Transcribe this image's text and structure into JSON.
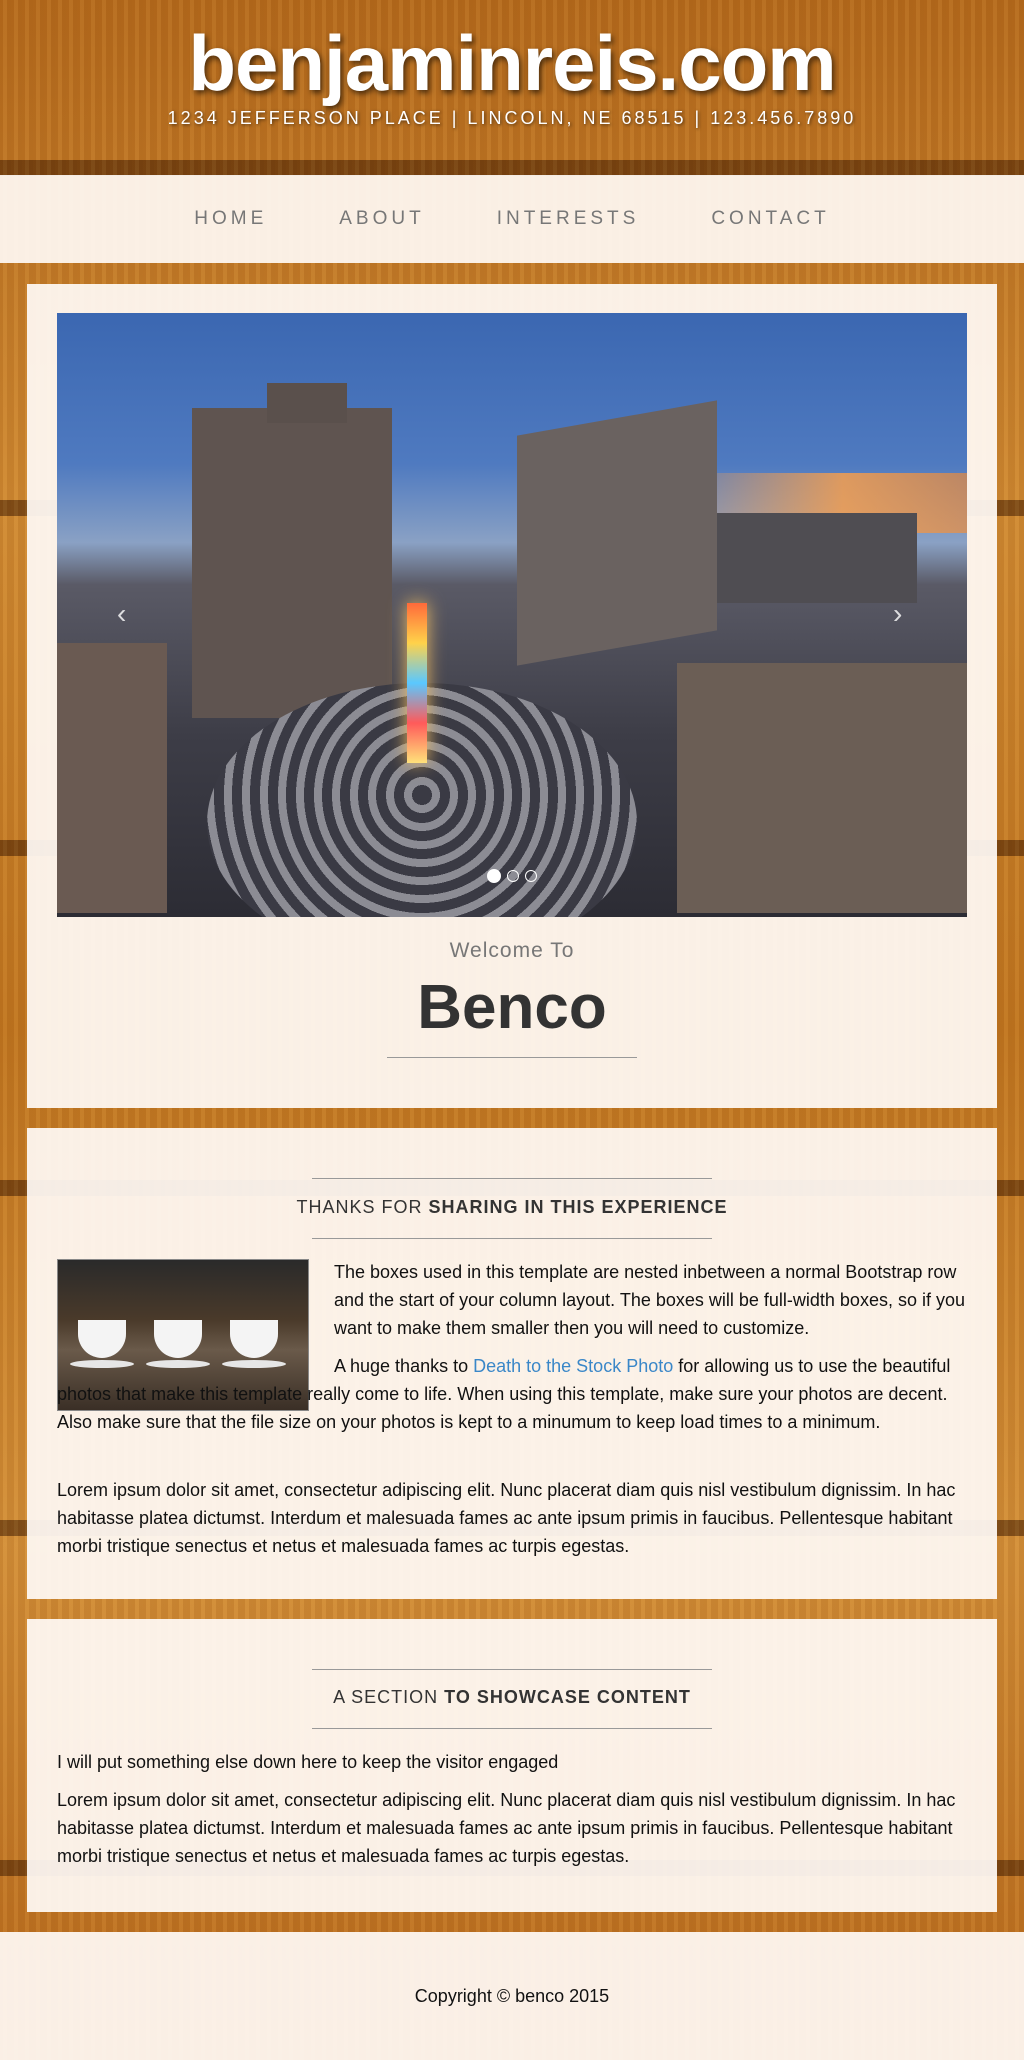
{
  "header": {
    "title": "benjaminreis.com",
    "address": "1234 JEFFERSON PLACE | LINCOLN, NE 68515 | 123.456.7890"
  },
  "nav": {
    "items": [
      {
        "label": "HOME"
      },
      {
        "label": "ABOUT"
      },
      {
        "label": "INTERESTS"
      },
      {
        "label": "CONTACT"
      }
    ]
  },
  "hero": {
    "prev_icon": "‹",
    "next_icon": "›",
    "slide_count": 3,
    "active_slide": 1,
    "welcome": "Welcome To",
    "name": "Benco"
  },
  "section1": {
    "title_light": "THANKS FOR ",
    "title_bold": "SHARING IN THIS EXPERIENCE",
    "p1": "The boxes used in this template are nested inbetween a normal Bootstrap row and the start of your column layout. The boxes will be full-width boxes, so if you want to make them smaller then you will need to customize.",
    "p2_before": "A huge thanks to ",
    "p2_link": "Death to the Stock Photo",
    "p2_after": " for allowing us to use the beautiful photos that make this template really come to life. When using this template, make sure your photos are decent. Also make sure that the file size on your photos is kept to a minumum to keep load times to a minimum.",
    "p3": "Lorem ipsum dolor sit amet, consectetur adipiscing elit. Nunc placerat diam quis nisl vestibulum dignissim. In hac habitasse platea dictumst. Interdum et malesuada fames ac ante ipsum primis in faucibus. Pellentesque habitant morbi tristique senectus et netus et malesuada fames ac turpis egestas."
  },
  "section2": {
    "title_light": "A SECTION ",
    "title_bold": "TO SHOWCASE CONTENT",
    "p1": "I will put something else down here to keep the visitor engaged",
    "p2": "Lorem ipsum dolor sit amet, consectetur adipiscing elit. Nunc placerat diam quis nisl vestibulum dignissim. In hac habitasse platea dictumst. Interdum et malesuada fames ac ante ipsum primis in faucibus. Pellentesque habitant morbi tristique senectus et netus et malesuada fames ac turpis egestas."
  },
  "footer": {
    "copyright": "Copyright © benco 2015"
  }
}
